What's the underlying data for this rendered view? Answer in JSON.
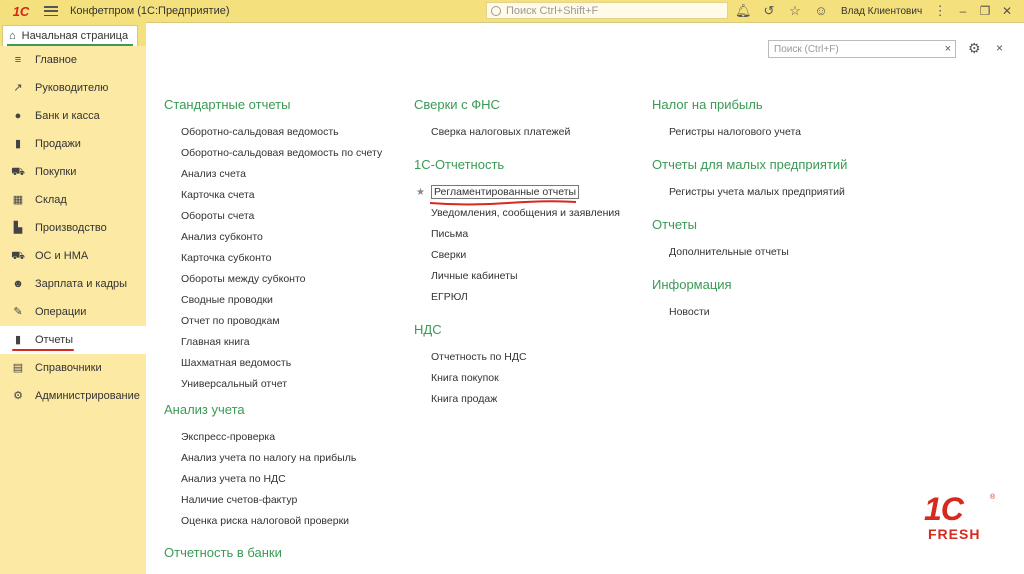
{
  "titlebar": {
    "logo": "1С",
    "app_title": "Конфетпром  (1С:Предприятие)",
    "search_placeholder": "Поиск Ctrl+Shift+F",
    "user": "Влад Клиентович"
  },
  "home_tab": {
    "label": "Начальная страница"
  },
  "sidebar": {
    "items": [
      {
        "label": "Главное",
        "icon": "≡"
      },
      {
        "label": "Руководителю",
        "icon": "↗"
      },
      {
        "label": "Банк и касса",
        "icon": "●"
      },
      {
        "label": "Продажи",
        "icon": "▮"
      },
      {
        "label": "Покупки",
        "icon": "⛟"
      },
      {
        "label": "Склад",
        "icon": "▦"
      },
      {
        "label": "Производство",
        "icon": "▙"
      },
      {
        "label": "ОС и НМА",
        "icon": "⛟"
      },
      {
        "label": "Зарплата и кадры",
        "icon": "☻"
      },
      {
        "label": "Операции",
        "icon": "✎"
      },
      {
        "label": "Отчеты",
        "icon": "▮"
      },
      {
        "label": "Справочники",
        "icon": "▤"
      },
      {
        "label": "Администрирование",
        "icon": "⚙"
      }
    ]
  },
  "panel": {
    "search_placeholder": "Поиск (Ctrl+F)",
    "clear": "×",
    "close": "×"
  },
  "col1": {
    "standard_title": "Стандартные отчеты",
    "standard": [
      "Оборотно-сальдовая ведомость",
      "Оборотно-сальдовая ведомость по счету",
      "Анализ счета",
      "Карточка счета",
      "Обороты счета",
      "Анализ субконто",
      "Карточка субконто",
      "Обороты между субконто",
      "Сводные проводки",
      "Отчет по проводкам",
      "Главная книга",
      "Шахматная ведомость",
      "Универсальный отчет"
    ],
    "analysis_title": "Анализ учета",
    "analysis": [
      "Экспресс-проверка",
      "Анализ учета по налогу на прибыль",
      "Анализ учета по НДС",
      "Наличие счетов-фактур",
      "Оценка риска налоговой проверки"
    ],
    "banks_title": "Отчетность в банки"
  },
  "col2": {
    "fns_title": "Сверки с ФНС",
    "fns": [
      "Сверка налоговых платежей"
    ],
    "rep_title": "1С-Отчетность",
    "rep": [
      "Регламентированные отчеты",
      "Уведомления, сообщения и заявления",
      "Письма",
      "Сверки",
      "Личные кабинеты",
      "ЕГРЮЛ"
    ],
    "nds_title": "НДС",
    "nds": [
      "Отчетность по НДС",
      "Книга покупок",
      "Книга продаж"
    ]
  },
  "col3": {
    "profit_title": "Налог на прибыль",
    "profit": [
      "Регистры налогового учета"
    ],
    "small_title": "Отчеты для малых предприятий",
    "small": [
      "Регистры учета малых предприятий"
    ],
    "reports_title": "Отчеты",
    "reports": [
      "Дополнительные отчеты"
    ],
    "info_title": "Информация",
    "info": [
      "Новости"
    ]
  },
  "brand": {
    "logo": "1С",
    "word": "FRESH",
    "reg": "®"
  },
  "colors": {
    "accent_green": "#3a9a55",
    "sidebar_bg": "#fbe9a4",
    "titlebar_bg": "#f5e07e",
    "marker_red": "#d72a1f"
  }
}
